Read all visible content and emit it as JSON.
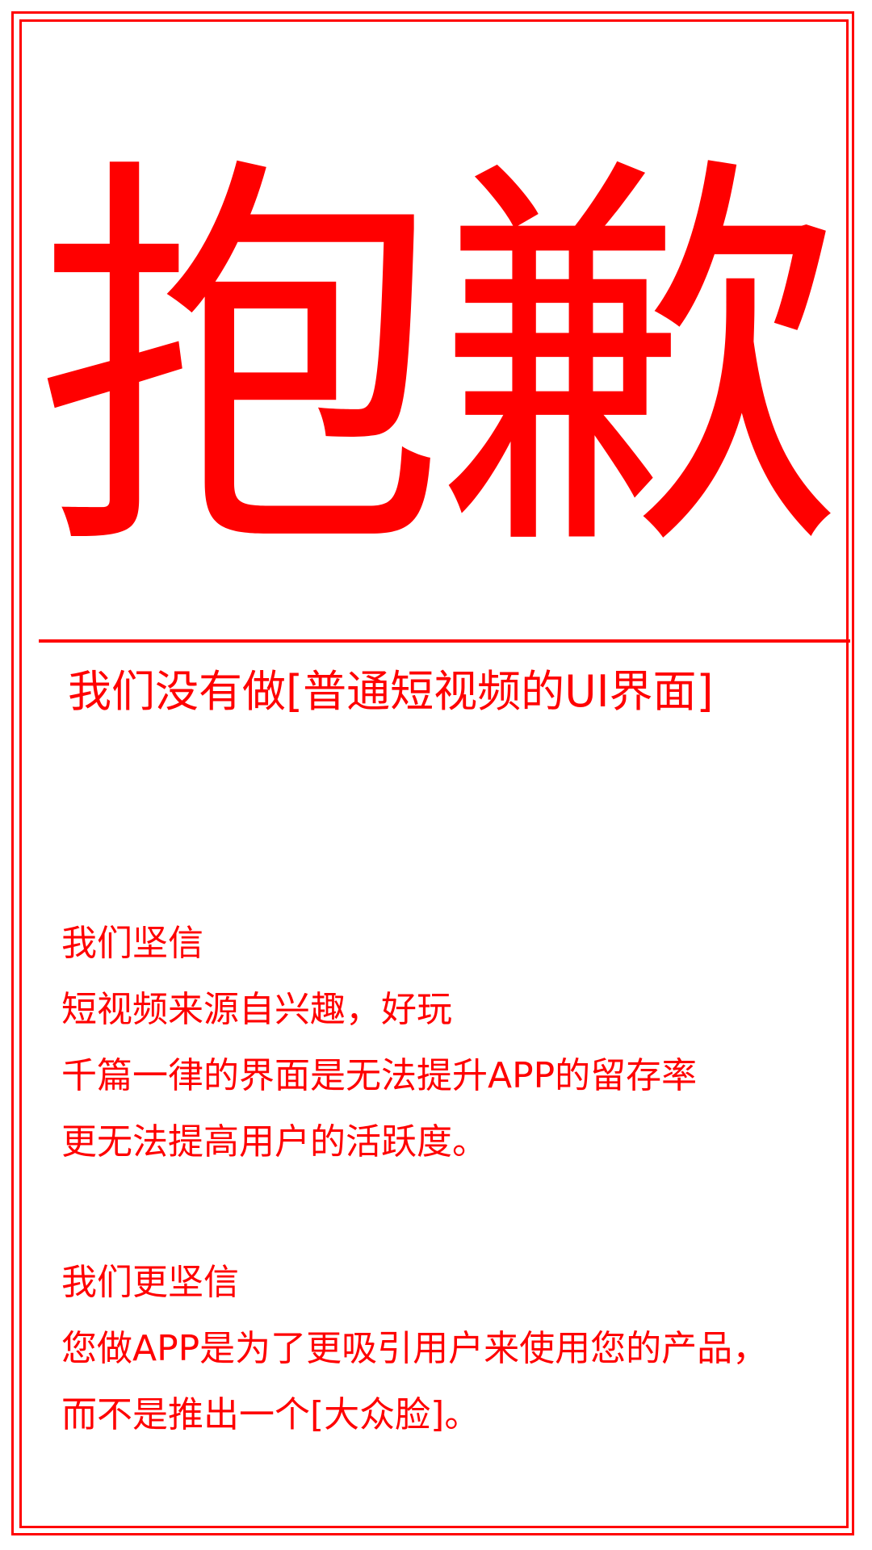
{
  "headline": "抱歉",
  "subtitle": "我们没有做[普通短视频的UI界面]",
  "paragraph_1": [
    "我们坚信",
    "短视频来源自兴趣，好玩",
    "千篇一律的界面是无法提升APP的留存率",
    "更无法提高用户的活跃度。"
  ],
  "paragraph_2": [
    "我们更坚信",
    "您做APP是为了更吸引用户来使用您的产品，",
    "而不是推出一个[大众脸]。"
  ],
  "colors": {
    "accent": "#ff0000",
    "background": "#ffffff"
  }
}
